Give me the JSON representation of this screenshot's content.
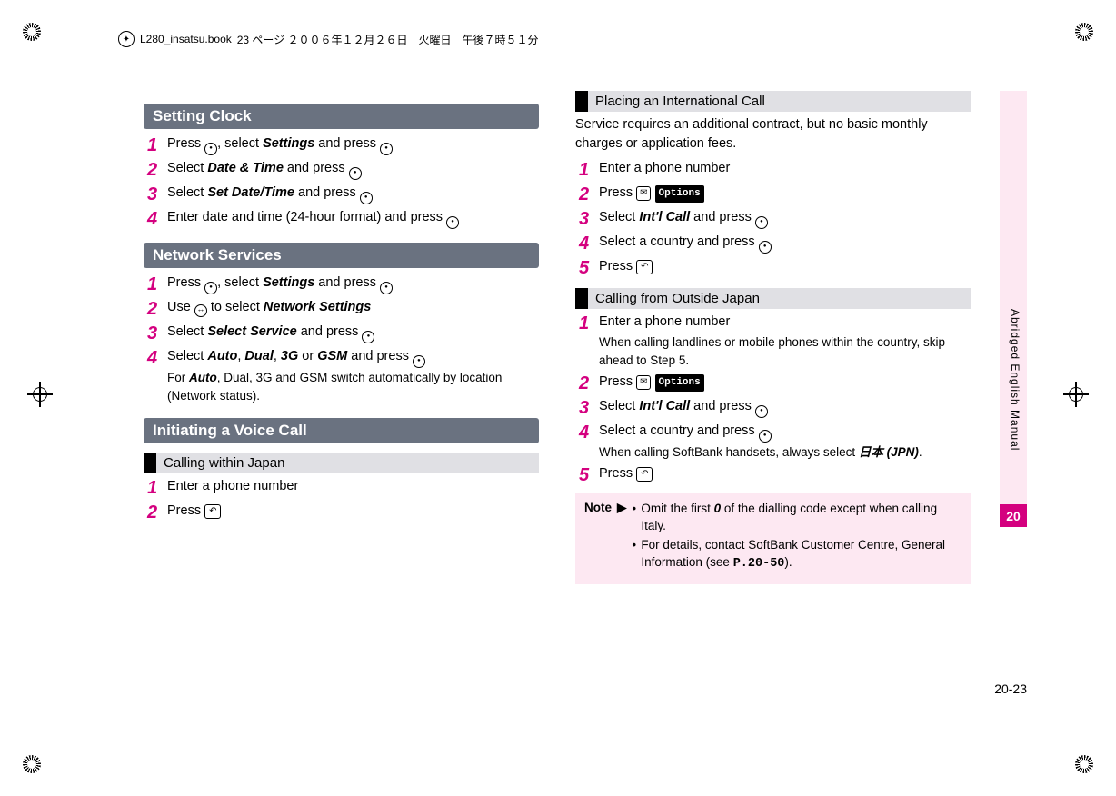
{
  "header": {
    "filename": "L280_insatsu.book",
    "page_info": "23 ページ ２００６年１２月２６日　火曜日　午後７時５１分"
  },
  "left": {
    "s1_title": "Setting Clock",
    "s1_1a": "Press ",
    "s1_1b": ", select ",
    "s1_1c": "Settings",
    "s1_1d": " and press ",
    "s1_2a": "Select ",
    "s1_2b": "Date & Time",
    "s1_2c": " and press ",
    "s1_3a": "Select ",
    "s1_3b": "Set Date/Time",
    "s1_3c": " and press ",
    "s1_4a": "Enter date and time (24-hour format) and press ",
    "s2_title": "Network Services",
    "s2_1a": "Press ",
    "s2_1b": ", select ",
    "s2_1c": "Settings",
    "s2_1d": " and press ",
    "s2_2a": "Use ",
    "s2_2b": " to select ",
    "s2_2c": "Network Settings",
    "s2_3a": "Select ",
    "s2_3b": "Select Service",
    "s2_3c": " and press ",
    "s2_4a": "Select ",
    "s2_4b": "Auto",
    "s2_4c": ", ",
    "s2_4d": "Dual",
    "s2_4e": ", ",
    "s2_4f": "3G",
    "s2_4g": " or ",
    "s2_4h": "GSM",
    "s2_4i": " and press ",
    "s2_4sub_a": "For ",
    "s2_4sub_b": "Auto",
    "s2_4sub_c": ", Dual, 3G and GSM switch automatically by location (Network status).",
    "s3_title": "Initiating a Voice Call",
    "s3_sub1": "Calling within Japan",
    "s3_1": "Enter a phone number",
    "s3_2": "Press "
  },
  "right": {
    "sub1": "Placing an International Call",
    "intro1": "Service requires an additional contract, but no basic monthly charges or application fees.",
    "r1_1": "Enter a phone number",
    "r1_2": "Press ",
    "options_label": "Options",
    "r1_3a": "Select ",
    "r1_3b": "Int'l Call",
    "r1_3c": " and press ",
    "r1_4": "Select a country and press ",
    "r1_5": "Press ",
    "sub2": "Calling from Outside Japan",
    "r2_1": "Enter a phone number",
    "r2_1sub": "When calling landlines or mobile phones within the country, skip ahead to Step 5.",
    "r2_2": "Press ",
    "r2_3a": "Select ",
    "r2_3b": "Int'l Call",
    "r2_3c": " and press ",
    "r2_4": "Select a country and press ",
    "r2_4sub_a": "When calling SoftBank handsets, always select ",
    "r2_4sub_b": "日本 (JPN)",
    "r2_4sub_c": ".",
    "r2_5": "Press ",
    "note_label": "Note",
    "note_arrow": "▶",
    "note1a": "Omit the first ",
    "note1b": "0",
    "note1c": " of the dialling code except when calling Italy.",
    "note2a": "For details, contact SoftBank Customer Centre, General Information (see ",
    "note2b": "P.20-50",
    "note2c": ")."
  },
  "side": {
    "text": "Abridged English Manual",
    "chapter": "20",
    "pagenum": "20-23"
  },
  "nums": {
    "n1": "1",
    "n2": "2",
    "n3": "3",
    "n4": "4",
    "n5": "5"
  },
  "icons": {
    "call": "↶",
    "mail": "✉"
  }
}
